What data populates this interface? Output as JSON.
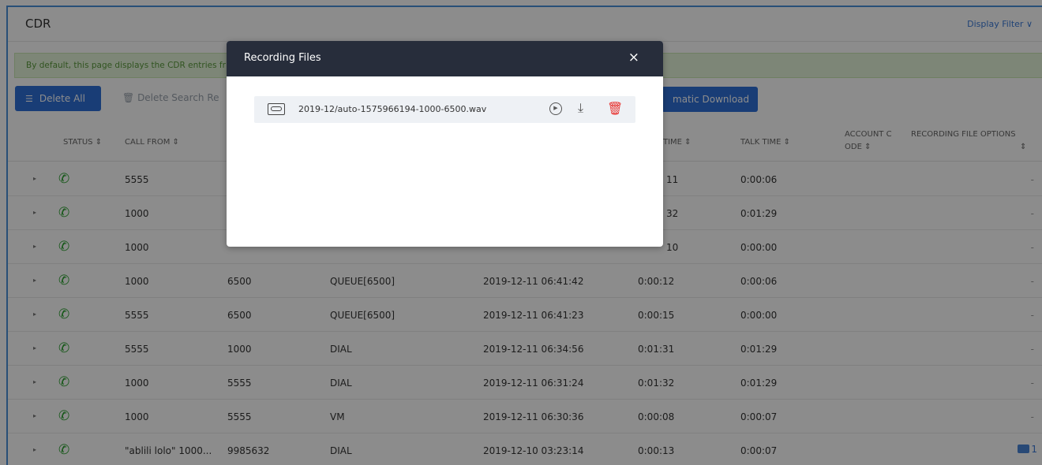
{
  "page": {
    "title": "CDR",
    "display_filter": "Display Filter ∨"
  },
  "notice": "By default, this page displays the CDR entries fr",
  "toolbar": {
    "delete_all": "Delete All",
    "delete_search": "Delete Search Re",
    "auto_download": "matic Download"
  },
  "table": {
    "headers": {
      "status": "STATUS ⇕",
      "call_from": "CALL FROM ⇕",
      "time": "TIME ⇕",
      "talk_time": "TALK TIME ⇕",
      "account_code_1": "ACCOUNT C",
      "account_code_2": "ODE ⇕",
      "rec_options_1": "RECORDING FILE OPTIONS",
      "rec_options_2": "⇕"
    },
    "rows": [
      {
        "from": "5555",
        "to": "",
        "action": "",
        "start": "",
        "time": "11",
        "talk": "0:00:06",
        "rec": "-"
      },
      {
        "from": "1000",
        "to": "",
        "action": "",
        "start": "",
        "time": "32",
        "talk": "0:01:29",
        "rec": "-"
      },
      {
        "from": "1000",
        "to": "",
        "action": "",
        "start": "",
        "time": "10",
        "talk": "0:00:00",
        "rec": "-"
      },
      {
        "from": "1000",
        "to": "6500",
        "action": "QUEUE[6500]",
        "start": "2019-12-11 06:41:42",
        "time": "0:00:12",
        "talk": "0:00:06",
        "rec": "-"
      },
      {
        "from": "5555",
        "to": "6500",
        "action": "QUEUE[6500]",
        "start": "2019-12-11 06:41:23",
        "time": "0:00:15",
        "talk": "0:00:00",
        "rec": "-"
      },
      {
        "from": "5555",
        "to": "1000",
        "action": "DIAL",
        "start": "2019-12-11 06:34:56",
        "time": "0:01:31",
        "talk": "0:01:29",
        "rec": "-"
      },
      {
        "from": "1000",
        "to": "5555",
        "action": "DIAL",
        "start": "2019-12-11 06:31:24",
        "time": "0:01:32",
        "talk": "0:01:29",
        "rec": "-"
      },
      {
        "from": "1000",
        "to": "5555",
        "action": "VM",
        "start": "2019-12-11 06:30:36",
        "time": "0:00:08",
        "talk": "0:00:07",
        "rec": "-"
      },
      {
        "from": "\"ablili lolo\" 1000...",
        "to": "9985632",
        "action": "DIAL",
        "start": "2019-12-10 03:23:14",
        "time": "0:00:13",
        "talk": "0:00:07",
        "rec": "1"
      }
    ]
  },
  "modal": {
    "title": "Recording Files",
    "close": "×",
    "file_name": "2019-12/auto-1575966194-1000-6500.wav"
  },
  "icons": {
    "caret": "▸",
    "phone": "✆",
    "play": "▶",
    "download": "⤓",
    "trash": "🗑"
  },
  "colors": {
    "primary": "#2e6fd8",
    "success": "#2aa12f",
    "danger": "#e8322f",
    "modal_header": "#272d3b"
  }
}
